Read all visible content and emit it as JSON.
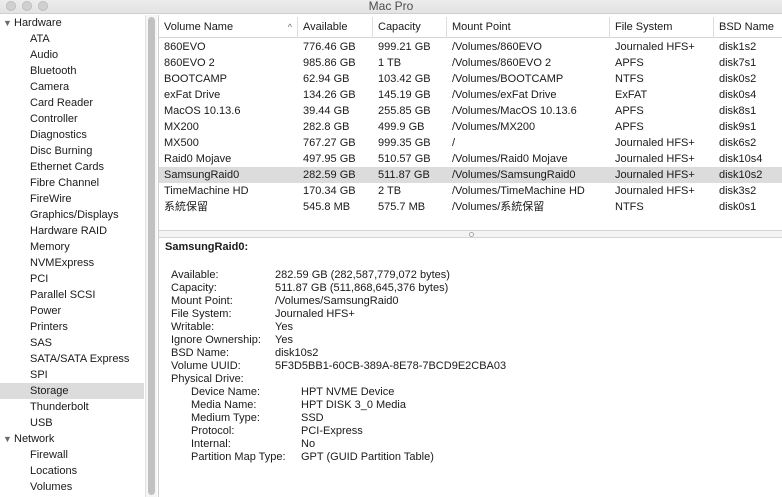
{
  "window": {
    "title": "Mac Pro"
  },
  "sidebar": {
    "groups": [
      {
        "label": "Hardware",
        "items": [
          "ATA",
          "Audio",
          "Bluetooth",
          "Camera",
          "Card Reader",
          "Controller",
          "Diagnostics",
          "Disc Burning",
          "Ethernet Cards",
          "Fibre Channel",
          "FireWire",
          "Graphics/Displays",
          "Hardware RAID",
          "Memory",
          "NVMExpress",
          "PCI",
          "Parallel SCSI",
          "Power",
          "Printers",
          "SAS",
          "SATA/SATA Express",
          "SPI",
          "Storage",
          "Thunderbolt",
          "USB"
        ]
      },
      {
        "label": "Network",
        "items": [
          "Firewall",
          "Locations",
          "Volumes"
        ]
      }
    ],
    "selected": "Storage"
  },
  "table": {
    "columns": [
      "Volume Name",
      "Available",
      "Capacity",
      "Mount Point",
      "File System",
      "BSD Name"
    ],
    "sort_indicator": "^",
    "rows": [
      [
        "860EVO",
        "776.46 GB",
        "999.21 GB",
        "/Volumes/860EVO",
        "Journaled HFS+",
        "disk1s2"
      ],
      [
        "860EVO 2",
        "985.86 GB",
        "1 TB",
        "/Volumes/860EVO 2",
        "APFS",
        "disk7s1"
      ],
      [
        "BOOTCAMP",
        "62.94 GB",
        "103.42 GB",
        "/Volumes/BOOTCAMP",
        "NTFS",
        "disk0s2"
      ],
      [
        "exFat Drive",
        "134.26 GB",
        "145.19 GB",
        "/Volumes/exFat Drive",
        "ExFAT",
        "disk0s4"
      ],
      [
        "MacOS 10.13.6",
        "39.44 GB",
        "255.85 GB",
        "/Volumes/MacOS 10.13.6",
        "APFS",
        "disk8s1"
      ],
      [
        "MX200",
        "282.8 GB",
        "499.9 GB",
        "/Volumes/MX200",
        "APFS",
        "disk9s1"
      ],
      [
        "MX500",
        "767.27 GB",
        "999.35 GB",
        "/",
        "Journaled HFS+",
        "disk6s2"
      ],
      [
        "Raid0 Mojave",
        "497.95 GB",
        "510.57 GB",
        "/Volumes/Raid0 Mojave",
        "Journaled HFS+",
        "disk10s4"
      ],
      [
        "SamsungRaid0",
        "282.59 GB",
        "511.87 GB",
        "/Volumes/SamsungRaid0",
        "Journaled HFS+",
        "disk10s2"
      ],
      [
        "TimeMachine HD",
        "170.34 GB",
        "2 TB",
        "/Volumes/TimeMachine HD",
        "Journaled HFS+",
        "disk3s2"
      ],
      [
        "系統保留",
        "545.8 MB",
        "575.7 MB",
        "/Volumes/系統保留",
        "NTFS",
        "disk0s1"
      ]
    ],
    "selected_row": 8
  },
  "detail": {
    "heading": "SamsungRaid0:",
    "fields": [
      [
        "Available:",
        "282.59 GB (282,587,779,072 bytes)"
      ],
      [
        "Capacity:",
        "511.87 GB (511,868,645,376 bytes)"
      ],
      [
        "Mount Point:",
        "/Volumes/SamsungRaid0"
      ],
      [
        "File System:",
        "Journaled HFS+"
      ],
      [
        "Writable:",
        "Yes"
      ],
      [
        "Ignore Ownership:",
        "Yes"
      ],
      [
        "BSD Name:",
        "disk10s2"
      ],
      [
        "Volume UUID:",
        "5F3D5BB1-60CB-389A-8E78-7BCD9E2CBA03"
      ],
      [
        "Physical Drive:",
        ""
      ]
    ],
    "physical_drive": [
      [
        "Device Name:",
        "HPT NVME Device"
      ],
      [
        "Media Name:",
        "HPT DISK 3_0 Media"
      ],
      [
        "Medium Type:",
        "SSD"
      ],
      [
        "Protocol:",
        "PCI-Express"
      ],
      [
        "Internal:",
        "No"
      ],
      [
        "Partition Map Type:",
        "GPT (GUID Partition Table)"
      ]
    ]
  }
}
